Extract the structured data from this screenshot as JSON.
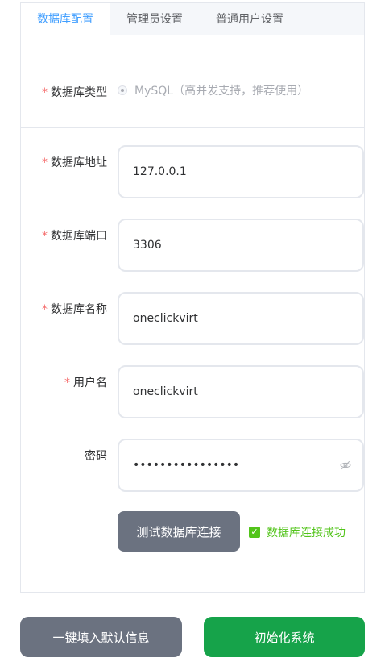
{
  "tabs": [
    {
      "label": "数据库配置",
      "active": true
    },
    {
      "label": "管理员设置",
      "active": false
    },
    {
      "label": "普通用户设置",
      "active": false
    }
  ],
  "form": {
    "db_type": {
      "label": "数据库类型",
      "required": true,
      "option": "MySQL（高并发支持，推荐使用）"
    },
    "db_host": {
      "label": "数据库地址",
      "required": true,
      "value": "127.0.0.1"
    },
    "db_port": {
      "label": "数据库端口",
      "required": true,
      "value": "3306"
    },
    "db_name": {
      "label": "数据库名称",
      "required": true,
      "value": "oneclickvirt"
    },
    "db_user": {
      "label": "用户名",
      "required": true,
      "value": "oneclickvirt"
    },
    "db_password": {
      "label": "密码",
      "required": false,
      "value": "••••••••••••••••"
    }
  },
  "required_mark": "*",
  "test_button": "测试数据库连接",
  "test_status": {
    "text": "数据库连接成功",
    "icon": "check-square-icon"
  },
  "footer": {
    "fill_default_button": "一键填入默认信息",
    "init_button": "初始化系统"
  },
  "colors": {
    "active_tab": "#409eff",
    "required": "#f56c6c",
    "success": "#52c41a",
    "gray_button": "#6b7280",
    "primary_button": "#16a34a"
  }
}
